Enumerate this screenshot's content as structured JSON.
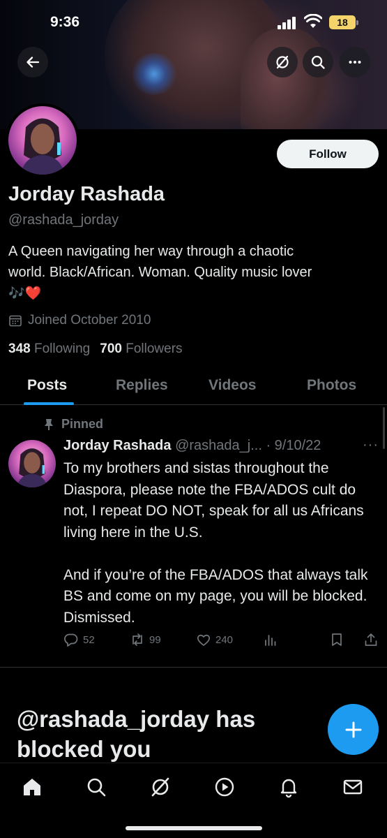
{
  "status_bar": {
    "time": "9:36",
    "battery": "18"
  },
  "header": {
    "back_icon": "arrow-left-icon",
    "grok_icon": "grok-icon",
    "search_icon": "search-icon",
    "more_icon": "more-horizontal-icon"
  },
  "profile": {
    "display_name": "Jorday Rashada",
    "handle": "@rashada_jorday",
    "bio_line1": "A Queen navigating her way through a chaotic",
    "bio_line2": "world. Black/African. Woman. Quality music lover",
    "bio_emoji": "🎶❤️",
    "joined": "Joined October 2010",
    "following_count": "348",
    "following_label": "Following",
    "followers_count": "700",
    "followers_label": "Followers",
    "follow_button": "Follow"
  },
  "tabs": [
    {
      "label": "Posts",
      "active": true
    },
    {
      "label": "Replies",
      "active": false
    },
    {
      "label": "Videos",
      "active": false
    },
    {
      "label": "Photos",
      "active": false
    }
  ],
  "pinned_tweet": {
    "pinned_label": "Pinned",
    "author_name": "Jorday Rashada",
    "author_meta": "@rashada_j... · 9/10/22",
    "more": "···",
    "text": "To my brothers and sistas throughout the Diaspora, please note the FBA/ADOS cult do not, I repeat DO NOT, speak for all us Africans living here in the U.S.\n\nAnd if you’re of the FBA/ADOS that always talk BS and come on my page, you will be blocked. Dismissed.",
    "replies": "52",
    "reposts": "99",
    "likes": "240"
  },
  "blocked_notice": "@rashada_jorday has blocked you",
  "bottom_nav": [
    "home-icon",
    "search-icon",
    "grok-icon",
    "video-icon",
    "notifications-icon",
    "messages-icon"
  ],
  "colors": {
    "accent": "#1d9bf0",
    "background": "#000000",
    "muted": "#71767b"
  }
}
